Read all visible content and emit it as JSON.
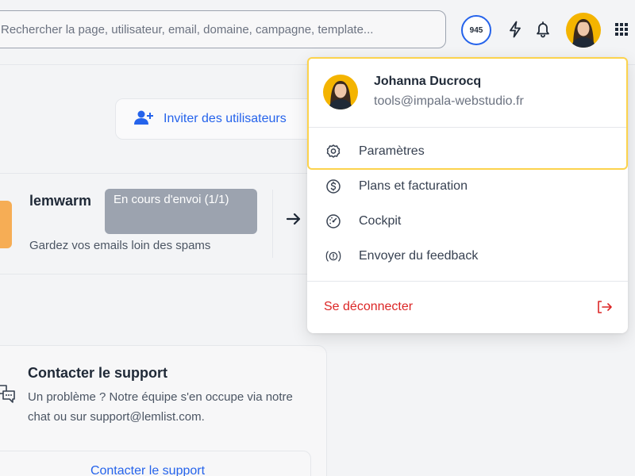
{
  "header": {
    "search_placeholder": "Rechercher la page, utilisateur, email, domaine, campagne, template...",
    "credits": "945",
    "icons": [
      "bolt-icon",
      "bell-icon",
      "avatar",
      "apps-grid-icon"
    ]
  },
  "main": {
    "invite_button": "Inviter des utilisateurs",
    "lemwarm": {
      "title": "lemwarm",
      "badge": "En cours d'envoi (1/1)",
      "description": "Gardez vos emails loin des spams"
    },
    "support": {
      "title": "Contacter le support",
      "text": "Un problème ? Notre équipe s'en occupe via notre chat ou sur support@lemlist.com.",
      "button": "Contacter le support"
    }
  },
  "user_menu": {
    "name": "Johanna Ducrocq",
    "email": "tools@impala-webstudio.fr",
    "items": [
      {
        "label": "Paramètres",
        "icon": "gear-icon"
      },
      {
        "label": "Plans et facturation",
        "icon": "dollar-circle-icon"
      },
      {
        "label": "Cockpit",
        "icon": "gauge-icon"
      },
      {
        "label": "Envoyer du feedback",
        "icon": "feedback-icon"
      }
    ],
    "logout": "Se déconnecter"
  },
  "colors": {
    "accent": "#2563eb",
    "danger": "#dc2626",
    "highlight": "#fcd34d",
    "badge": "#9ca3af",
    "warm_thumb": "#f6ad55"
  }
}
